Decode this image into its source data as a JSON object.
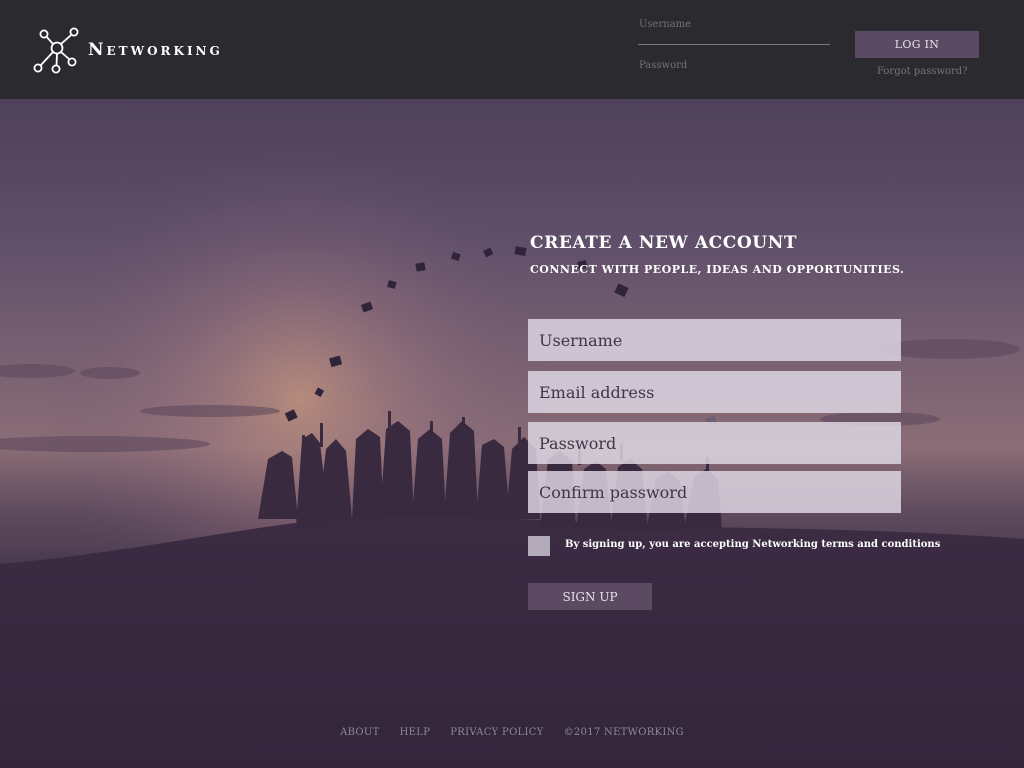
{
  "header": {
    "brand_name": "Networking",
    "login": {
      "username_label": "Username",
      "password_label": "Password",
      "login_button": "LOG IN",
      "forgot_password": "Forgot password?"
    }
  },
  "signup": {
    "title": "CREATE A NEW ACCOUNT",
    "subtitle": "CONNECT WITH PEOPLE, IDEAS AND OPPORTUNITIES.",
    "fields": {
      "username_placeholder": "Username",
      "email_placeholder": "Email address",
      "password_placeholder": "Password",
      "confirm_placeholder": "Confirm password"
    },
    "terms_text": "By signing up, you are accepting Networking terms and conditions",
    "terms_checked": false,
    "signup_button": "SIGN UP"
  },
  "footer": {
    "links": [
      "ABOUT",
      "HELP",
      "PRIVACY POLICY"
    ],
    "copyright": "©2017 NETWORKING"
  },
  "colors": {
    "header_bg": "#2a2a2f",
    "accent": "#5a4a63",
    "field_bg": "#e1dbe6"
  },
  "icons": {
    "logo": "network-nodes-icon"
  }
}
